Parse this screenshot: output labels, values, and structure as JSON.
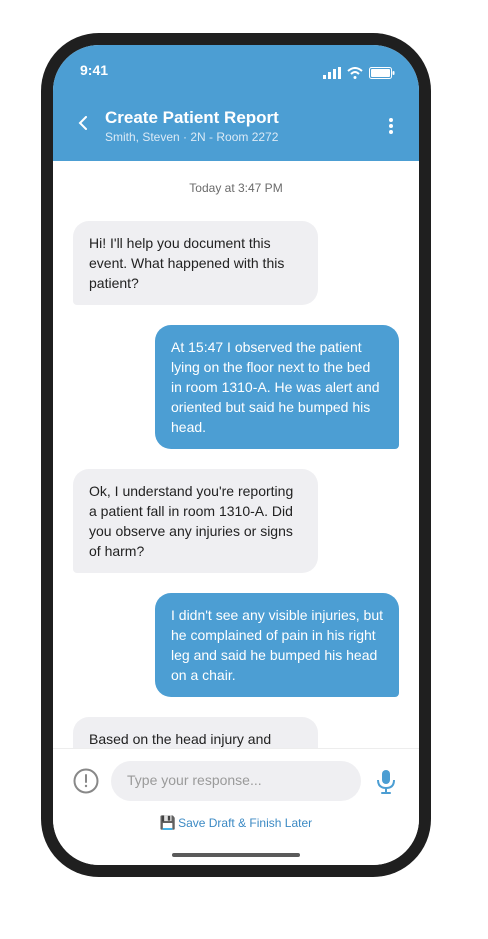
{
  "status_bar": {
    "time": "9:41"
  },
  "header": {
    "title": "Create Patient Report",
    "subtitle": "Smith, Steven · 2N - Room 2272"
  },
  "chat": {
    "timestamp": "Today at 3:47 PM",
    "messages": [
      {
        "role": "ai",
        "text": "Hi! I'll help you document this event. What happened with this patient?"
      },
      {
        "role": "user",
        "text": "At 15:47 I observed the patient lying on the floor next to the bed in room 1310-A. He was alert and oriented but said he bumped his head."
      },
      {
        "role": "ai",
        "text": "Ok, I understand you're reporting a patient fall in room 1310-A. Did you observe any injuries or signs of harm?"
      },
      {
        "role": "user",
        "text": "I didn't see any visible injuries, but he complained of pain in his right leg and said he bumped his head on a chair."
      },
      {
        "role": "ai",
        "text": "Based on the head injury and"
      }
    ]
  },
  "footer": {
    "input_placeholder": "Type your response...",
    "save_label": "Save Draft & Finish Later",
    "save_icon": "💾"
  },
  "colors": {
    "primary": "#4c9ed3",
    "ai_bubble": "#efeff2"
  },
  "icons": [
    "back-chevron-icon",
    "more-vertical-icon",
    "info-icon",
    "microphone-icon",
    "floppy-disk-icon",
    "signal-icon",
    "wifi-icon",
    "battery-icon"
  ]
}
